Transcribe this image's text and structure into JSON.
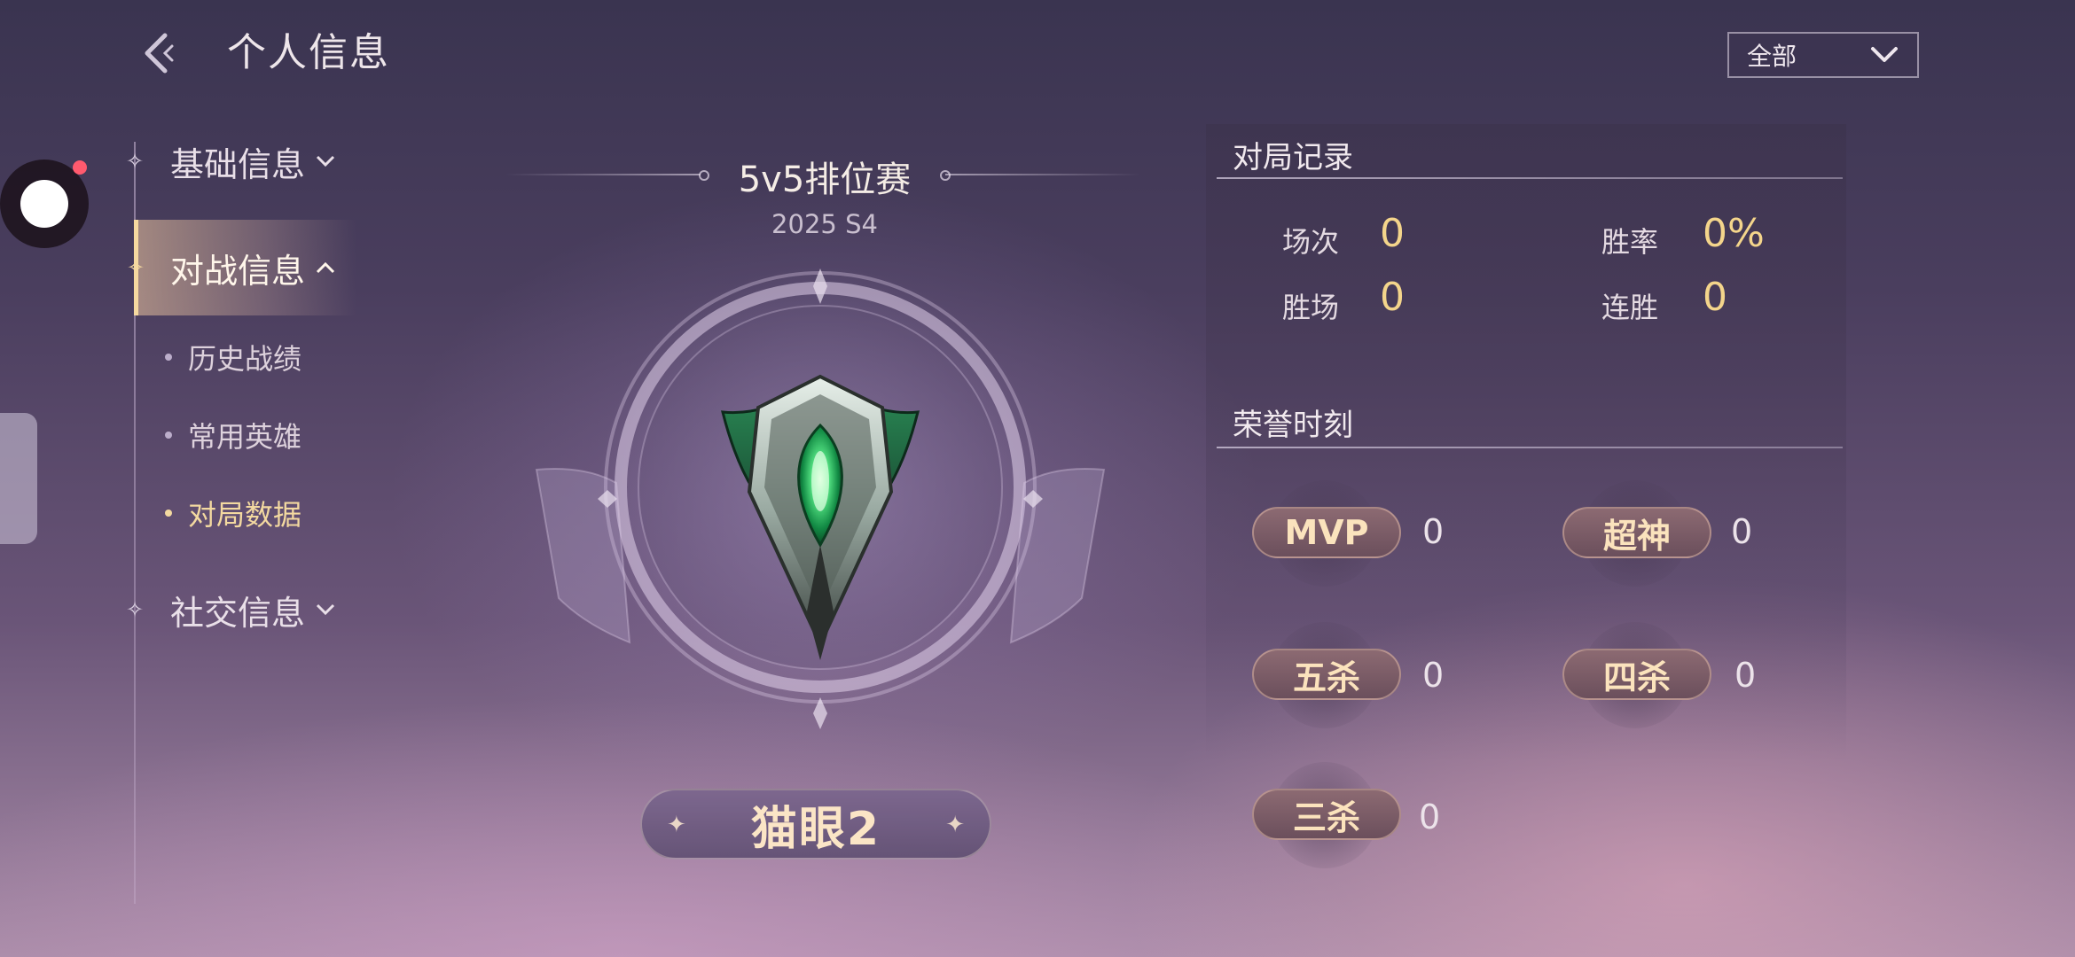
{
  "header": {
    "title": "个人信息",
    "filter": {
      "selected": "全部"
    }
  },
  "nav": {
    "basic": "基础信息",
    "battle": "对战信息",
    "battle_subitems": [
      "历史战绩",
      "常用英雄",
      "对局数据"
    ],
    "social": "社交信息"
  },
  "rank": {
    "mode": "5v5排位赛",
    "season": "2025 S4",
    "tier_name": "猫眼2"
  },
  "record": {
    "title": "对局记录",
    "matches_label": "场次",
    "matches_value": "0",
    "winrate_label": "胜率",
    "winrate_value": "0%",
    "wins_label": "胜场",
    "wins_value": "0",
    "streak_label": "连胜",
    "streak_value": "0"
  },
  "honors": {
    "title": "荣誉时刻",
    "items": [
      {
        "label": "MVP",
        "value": "0"
      },
      {
        "label": "超神",
        "value": "0"
      },
      {
        "label": "五杀",
        "value": "0"
      },
      {
        "label": "四杀",
        "value": "0"
      },
      {
        "label": "三杀",
        "value": "0"
      }
    ]
  },
  "colors": {
    "accent_gold": "#f4d58b",
    "emblem_green": "#3fd678",
    "badge_bg": "#7a5c66"
  }
}
